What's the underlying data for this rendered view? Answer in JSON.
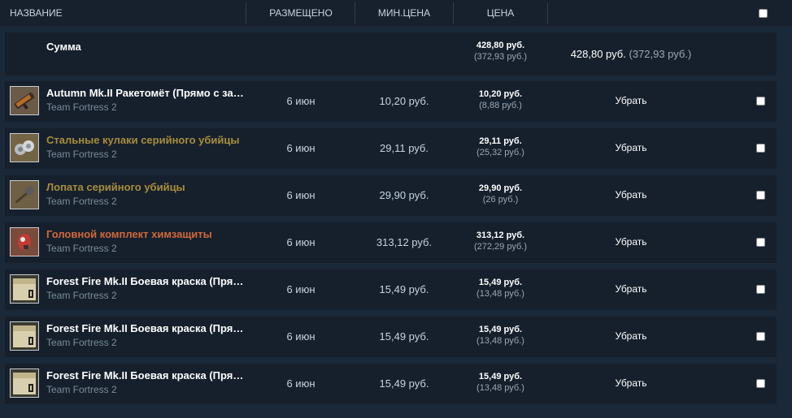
{
  "header": {
    "name": "НАЗВАНИЕ",
    "listed": "РАЗМЕЩЕНО",
    "min_price": "МИН.ЦЕНА",
    "price": "ЦЕНА"
  },
  "sum": {
    "label": "Сумма",
    "price": "428,80 руб.",
    "price_sub": "(372,93 руб.)",
    "total": "428,80 руб.",
    "total_sub": "(372,93 руб.)"
  },
  "colors": {
    "normal": "#ffffff",
    "strange": "#a88d3b",
    "unusual": "#d0693a"
  },
  "listings": [
    {
      "name": "Autumn Mk.II Ракетомёт (Прямо с завода)",
      "game": "Team Fortress 2",
      "listed": "6 июн",
      "min_price": "10,20 руб.",
      "price": "10,20 руб.",
      "price_sub": "(8,88 руб.)",
      "remove": "Убрать",
      "name_color": "#ffffff",
      "icon": "rocket-launcher-icon"
    },
    {
      "name": "Стальные кулаки серийного убийцы",
      "game": "Team Fortress 2",
      "listed": "6 июн",
      "min_price": "29,11 руб.",
      "price": "29,11 руб.",
      "price_sub": "(25,32 руб.)",
      "remove": "Убрать",
      "name_color": "#a88d3b",
      "icon": "steel-fists-icon"
    },
    {
      "name": "Лопата серийного убийцы",
      "game": "Team Fortress 2",
      "listed": "6 июн",
      "min_price": "29,90 руб.",
      "price": "29,90 руб.",
      "price_sub": "(26 руб.)",
      "remove": "Убрать",
      "name_color": "#a88d3b",
      "icon": "shovel-icon"
    },
    {
      "name": "Головной комплект химзащиты",
      "game": "Team Fortress 2",
      "listed": "6 июн",
      "min_price": "313,12 руб.",
      "price": "313,12 руб.",
      "price_sub": "(272,29 руб.)",
      "remove": "Убрать",
      "name_color": "#d0693a",
      "icon": "hazmat-headcase-icon"
    },
    {
      "name": "Forest Fire Mk.II Боевая краска (Прямо с завода)",
      "game": "Team Fortress 2",
      "listed": "6 июн",
      "min_price": "15,49 руб.",
      "price": "15,49 руб.",
      "price_sub": "(13,48 руб.)",
      "remove": "Убрать",
      "name_color": "#ffffff",
      "icon": "war-paint-icon"
    },
    {
      "name": "Forest Fire Mk.II Боевая краска (Прямо с завода)",
      "game": "Team Fortress 2",
      "listed": "6 июн",
      "min_price": "15,49 руб.",
      "price": "15,49 руб.",
      "price_sub": "(13,48 руб.)",
      "remove": "Убрать",
      "name_color": "#ffffff",
      "icon": "war-paint-icon"
    },
    {
      "name": "Forest Fire Mk.II Боевая краска (Прямо с завода)",
      "game": "Team Fortress 2",
      "listed": "6 июн",
      "min_price": "15,49 руб.",
      "price": "15,49 руб.",
      "price_sub": "(13,48 руб.)",
      "remove": "Убрать",
      "name_color": "#ffffff",
      "icon": "war-paint-icon"
    }
  ]
}
